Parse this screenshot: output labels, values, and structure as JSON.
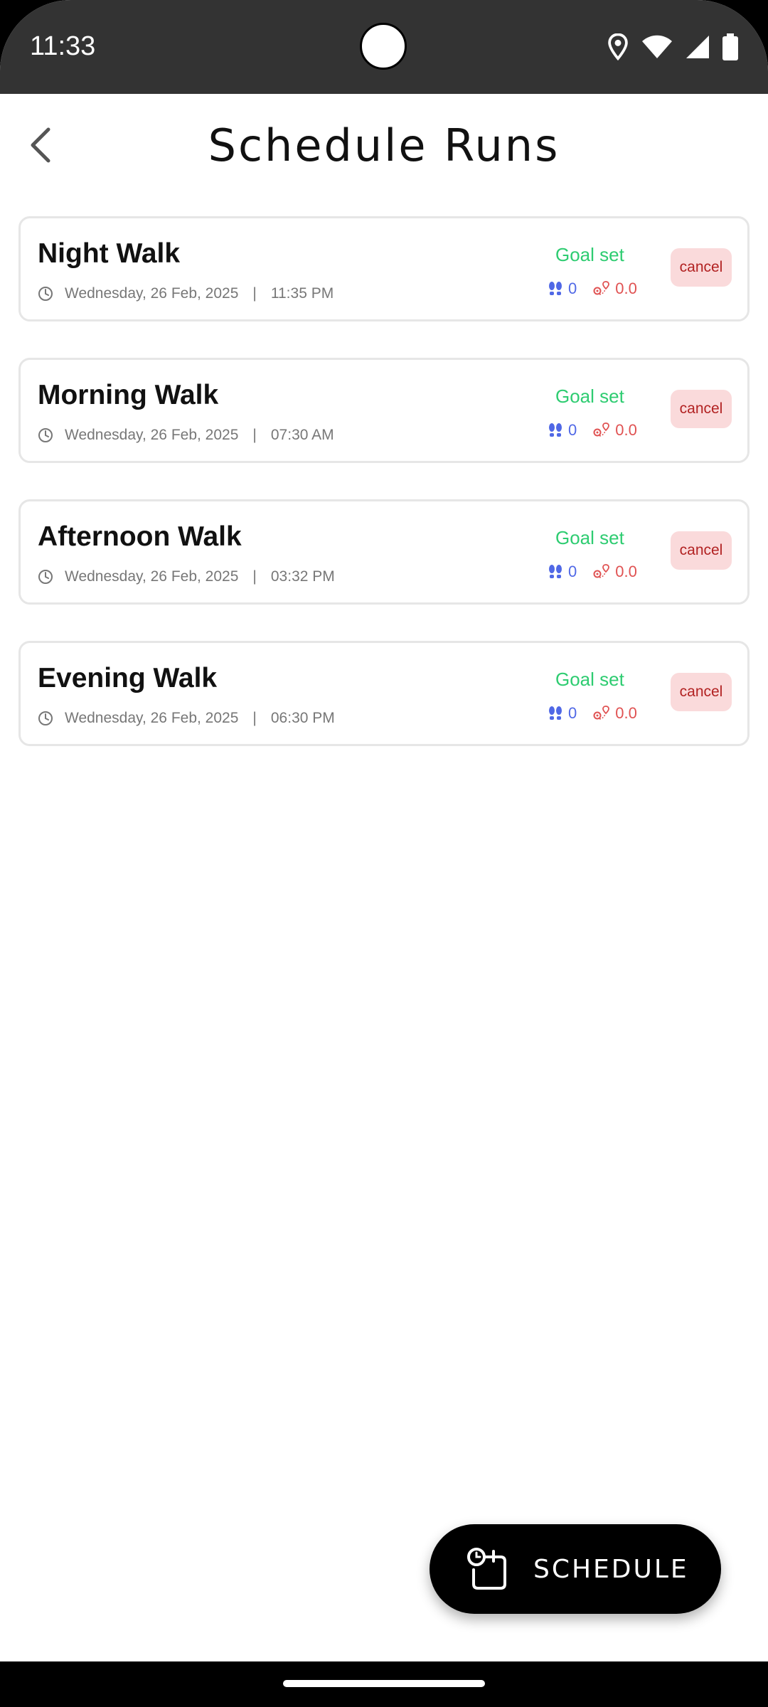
{
  "status_bar": {
    "time": "11:33"
  },
  "header": {
    "title": "Schedule Runs"
  },
  "runs": [
    {
      "name": "Night Walk",
      "date": "Wednesday, 26 Feb, 2025",
      "separator": "|",
      "time": "11:35 PM",
      "goal_label": "Goal set",
      "steps": "0",
      "distance": "0.0",
      "cancel_label": "cancel"
    },
    {
      "name": "Morning Walk",
      "date": "Wednesday, 26 Feb, 2025",
      "separator": "|",
      "time": "07:30 AM",
      "goal_label": "Goal set",
      "steps": "0",
      "distance": "0.0",
      "cancel_label": "cancel"
    },
    {
      "name": "Afternoon Walk",
      "date": "Wednesday, 26 Feb, 2025",
      "separator": "|",
      "time": "03:32 PM",
      "goal_label": "Goal set",
      "steps": "0",
      "distance": "0.0",
      "cancel_label": "cancel"
    },
    {
      "name": "Evening Walk",
      "date": "Wednesday, 26 Feb, 2025",
      "separator": "|",
      "time": "06:30 PM",
      "goal_label": "Goal set",
      "steps": "0",
      "distance": "0.0",
      "cancel_label": "cancel"
    }
  ],
  "fab": {
    "label": "SCHEDULE",
    "icon": "schedule-clock-icon"
  },
  "colors": {
    "goal": "#2ecc71",
    "steps": "#5068e6",
    "distance": "#e05252",
    "cancel_bg": "#fadadb",
    "cancel_text": "#b22222",
    "status_bar": "#333333"
  }
}
